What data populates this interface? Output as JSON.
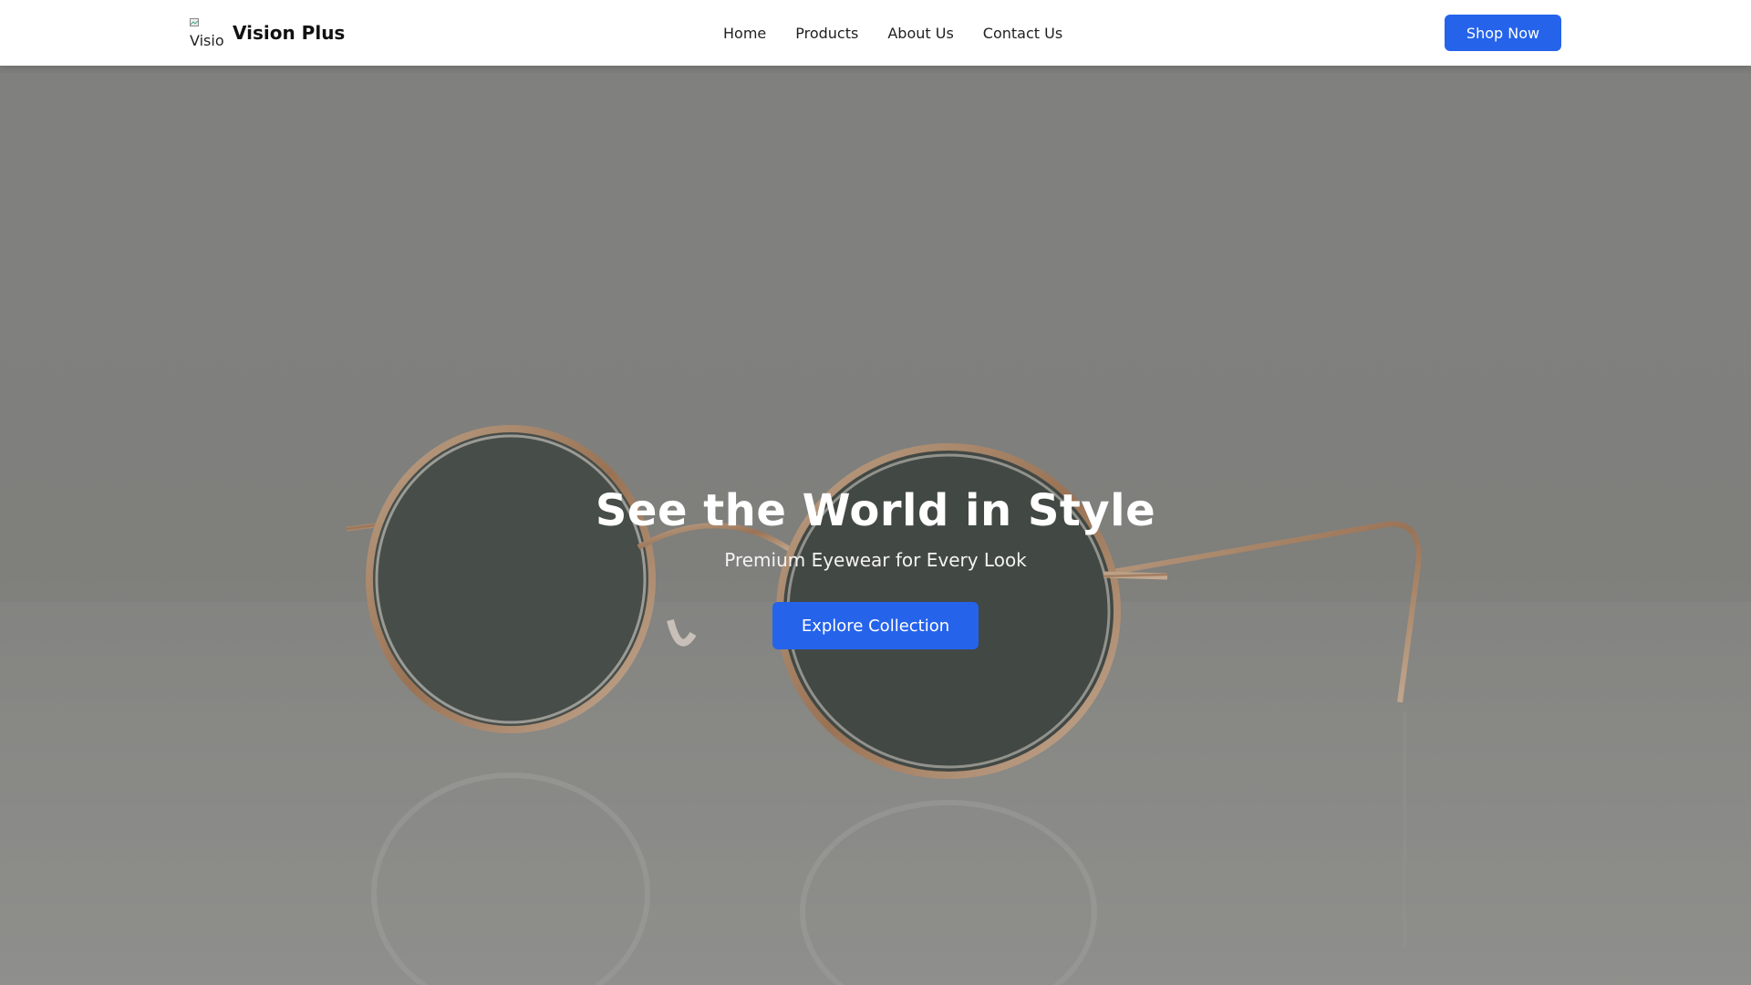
{
  "brand": {
    "logo_alt": "Vision Plus",
    "name": "Vision Plus",
    "logo_icon": "broken-image-icon"
  },
  "nav": {
    "links": [
      "Home",
      "Products",
      "About Us",
      "Contact Us"
    ]
  },
  "header": {
    "cta_label": "Shop Now"
  },
  "hero": {
    "title": "See the World in Style",
    "subtitle": "Premium Eyewear for Every Look",
    "cta_label": "Explore Collection",
    "background": "round-sunglasses-photo"
  },
  "colors": {
    "accent": "#2563eb",
    "nav_bg": "#ffffff",
    "hero_overlay": "#7d7d7b"
  }
}
